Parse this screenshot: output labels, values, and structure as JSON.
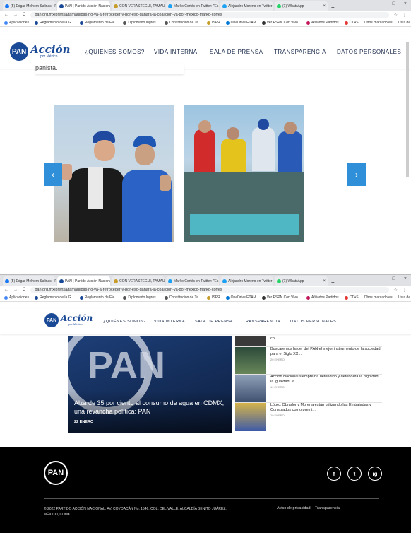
{
  "browser": {
    "tabs": [
      {
        "label": "(5) Edgar Melhem Salinas - Fr",
        "color": "#1877f2"
      },
      {
        "label": "PAN | Partido Acción Nacional",
        "color": "#1a4a96",
        "active": true
      },
      {
        "label": "CON VERASTEGUI, TAMAULI...",
        "color": "#c79c2a"
      },
      {
        "label": "Marko Cortés en Twitter: \"Es",
        "color": "#1da1f2"
      },
      {
        "label": "Alejandro Moreno en Twitter",
        "color": "#1da1f2"
      },
      {
        "label": "(1) WhatsApp",
        "color": "#25d366"
      }
    ],
    "url": "pan.org.mx/prensa/tamaulipas-no-va-a-retroceder-y-por-eso-ganara-la-coalicion-va-por-mexico-marko-cortes",
    "bookmarks": [
      {
        "label": "Aplicaciones",
        "color": "#4285f4"
      },
      {
        "label": "Reglamento de la G...",
        "color": "#1a4a96"
      },
      {
        "label": "Reglamento de Ele...",
        "color": "#1a4a96"
      },
      {
        "label": "Diplomado Ingres...",
        "color": "#555"
      },
      {
        "label": "Constitución de Ta...",
        "color": "#555"
      },
      {
        "label": "ISPR",
        "color": "#c79c2a"
      },
      {
        "label": "OneDrive ETAM",
        "color": "#0078d4"
      },
      {
        "label": "Ver ESPN Con Vivo...",
        "color": "#333"
      },
      {
        "label": "Afiliados Partidos",
        "color": "#c2185b"
      },
      {
        "label": "CTAS",
        "color": "#e53935"
      }
    ],
    "bookmarks_right": [
      "Otros marcadores",
      "Lista de lectura"
    ]
  },
  "site": {
    "logo_text": "PAN",
    "logo_word": "Acción",
    "logo_sub": "por México",
    "nav": [
      "¿QUIÉNES SOMOS?",
      "VIDA INTERNA",
      "SALA DE PRENSA",
      "TRANSPARENCIA",
      "DATOS PERSONALES"
    ]
  },
  "article": {
    "fragment": "panista.",
    "prev": "‹",
    "next": "›"
  },
  "news": {
    "main_title": "Alza de 35 por ciento al consumo de agua en CDMX, una revancha política: PAN",
    "main_date": "22 ENERO",
    "side_top": "co...",
    "side": [
      {
        "title": "Buscaremos hacer del PAN el mejor instrumento de la sociedad para el Siglo XX...",
        "date": "20 ENERO"
      },
      {
        "title": "Acción Nacional siempre ha defendido y defenderá la dignidad, la igualdad, la...",
        "date": "19 ENERO"
      },
      {
        "title": "López Obrador y Morena están utilizando las Embajadas y Consulados como premi...",
        "date": "19 ENERO"
      }
    ]
  },
  "footer": {
    "logo_text": "PAN",
    "address": "© 2022 PARTIDO ACCIÓN NACIONAL, AV. COYOACÁN No. 1546, COL. DEL VALLE, ALCALDÍA BENITO JUÁREZ, MÉXICO, CDMX.",
    "links": [
      "Aviso de privacidad",
      "Transparencia"
    ],
    "social": [
      "f",
      "t",
      "ig"
    ]
  }
}
